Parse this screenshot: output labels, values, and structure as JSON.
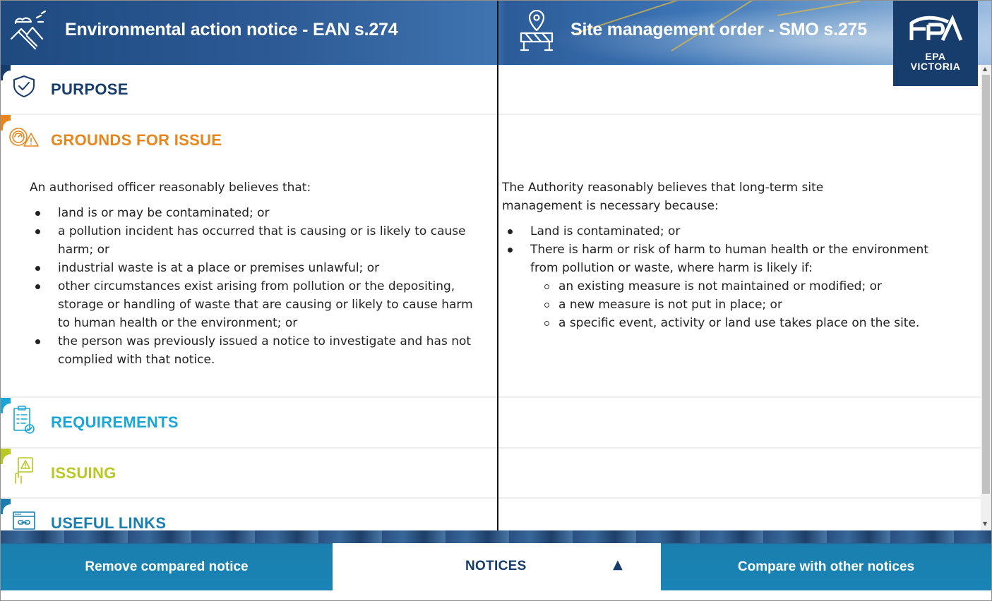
{
  "header": {
    "left_title": "Environmental action notice - EAN s.274",
    "right_title": "Site management order - SMO s.275",
    "left_icon": "landscape-weather-icon",
    "right_icon": "site-location-barrier-icon",
    "logo": {
      "line1": "EPA",
      "line2": "VICTORIA",
      "icon": "epa-logo"
    }
  },
  "sections": [
    {
      "label": "PURPOSE",
      "icon": "shield-check-icon",
      "color": "#173d6c"
    },
    {
      "label": "GROUNDS FOR ISSUE",
      "icon": "warning-gauge-icon",
      "color": "#e8851d"
    },
    {
      "label": "REQUIREMENTS",
      "icon": "checklist-icon",
      "color": "#1ba6d8"
    },
    {
      "label": "ISSUING",
      "icon": "hand-warning-icon",
      "color": "#b9c825"
    },
    {
      "label": "USEFUL LINKS",
      "icon": "browser-link-icon",
      "color": "#1a7fb0"
    }
  ],
  "grounds": {
    "left": {
      "intro": "An authorised officer reasonably believes that:",
      "bullets": [
        "land is or may be contaminated; or",
        "a pollution incident has occurred that is causing or is likely to cause harm; or",
        "industrial waste is at a place or premises unlawful; or",
        "other circumstances exist arising from pollution or the depositing, storage or handling of waste that are causing or likely to cause harm to human health or the environment; or",
        "the person was previously issued a notice to investigate and has not complied with that notice."
      ]
    },
    "right": {
      "intro": "The Authority reasonably believes that long-term site management is necessary because:",
      "bullets": [
        "Land is contaminated; or",
        "There is harm or risk of harm to human health or the environment from pollution or waste, where harm is likely if:"
      ],
      "sub_bullets": [
        "an existing measure is not maintained or modified; or",
        "a new measure is not put in place; or",
        "a specific event, activity or land use takes place on the site."
      ]
    }
  },
  "footer": {
    "remove": "Remove compared notice",
    "notices": "NOTICES",
    "compare": "Compare with other notices",
    "caret": "▲"
  }
}
